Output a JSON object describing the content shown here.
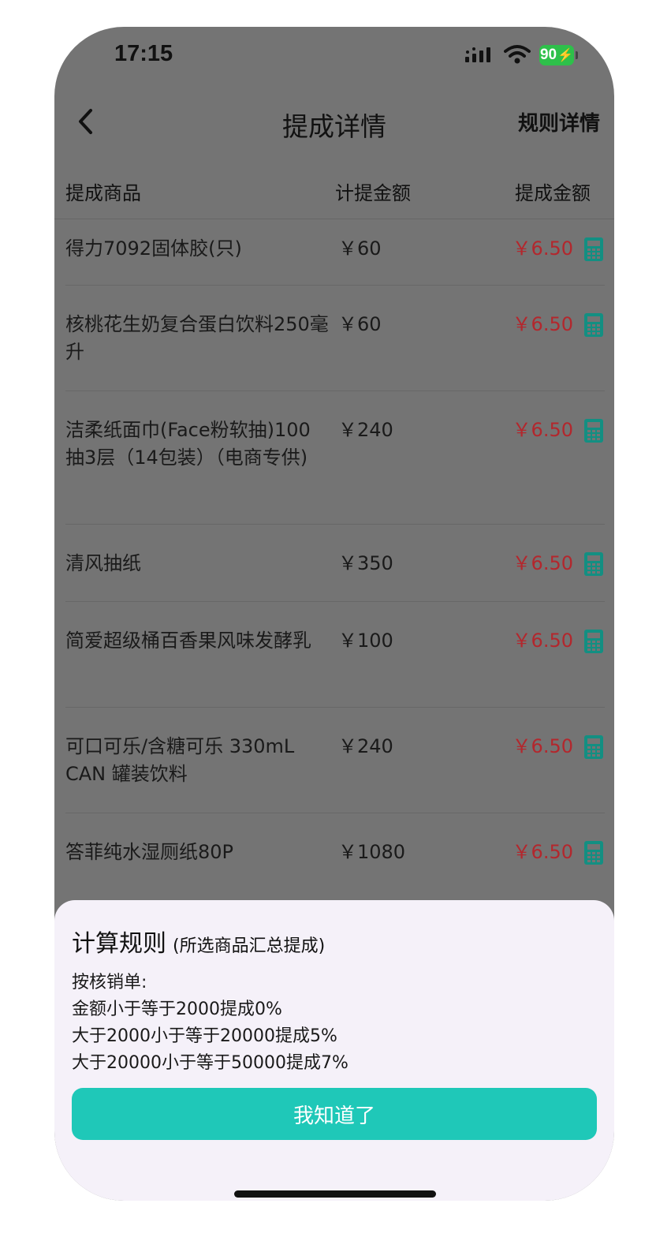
{
  "status_bar": {
    "time": "17:15",
    "battery": "90"
  },
  "nav": {
    "title": "提成详情",
    "right_link": "规则详情"
  },
  "table": {
    "headers": {
      "product": "提成商品",
      "base_amount": "计提金额",
      "commission": "提成金额"
    },
    "rows": [
      {
        "name": "得力7092固体胶(只)",
        "amount": "￥60",
        "commission": "￥6.50"
      },
      {
        "name": "核桃花生奶复合蛋白饮料250毫升",
        "amount": "￥60",
        "commission": "￥6.50"
      },
      {
        "name": "洁柔纸面巾(Face粉软抽)100抽3层（14包装）（电商专供)",
        "amount": "￥240",
        "commission": "￥6.50"
      },
      {
        "name": "清风抽纸",
        "amount": "￥350",
        "commission": "￥6.50"
      },
      {
        "name": "简爱超级桶百香果风味发酵乳",
        "amount": "￥100",
        "commission": "￥6.50"
      },
      {
        "name": "可口可乐/含糖可乐 330mL CAN 罐装饮料",
        "amount": "￥240",
        "commission": "￥6.50"
      },
      {
        "name": "答菲纯水湿厕纸80P",
        "amount": "￥1080",
        "commission": "￥6.50"
      }
    ]
  },
  "rule_sheet": {
    "title": "计算规则",
    "subtitle": "(所选商品汇总提成)",
    "lines": [
      "按核销单:",
      "金额小于等于2000提成0%",
      "大于2000小于等于20000提成5%",
      "大于20000小于等于50000提成7%"
    ],
    "button_label": "我知道了"
  },
  "colors": {
    "overlay_bg": "#747474",
    "commission_red": "#b3272d",
    "calculator_teal": "#138f82",
    "button_teal": "#1fc8b8",
    "sheet_bg": "#f5f1f9"
  }
}
